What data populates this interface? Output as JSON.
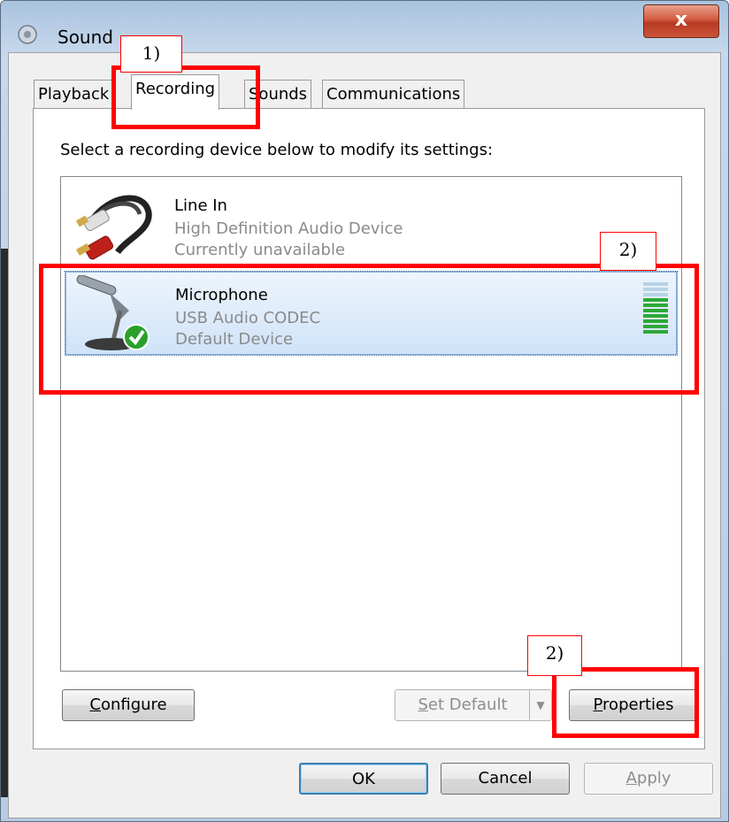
{
  "window": {
    "title": "Sound",
    "close_label": "x"
  },
  "tabs": [
    {
      "label": "Playback",
      "active": false
    },
    {
      "label": "Recording",
      "active": true
    },
    {
      "label": "Sounds",
      "active": false
    },
    {
      "label": "Communications",
      "active": false
    }
  ],
  "instruction": "Select a recording device below to modify its settings:",
  "devices": [
    {
      "name": "Line In",
      "driver": "High Definition Audio Device",
      "status": "Currently unavailable",
      "icon": "rca-cable-icon",
      "selected": false
    },
    {
      "name": "Microphone",
      "driver": "USB Audio CODEC",
      "status": "Default Device",
      "icon": "microphone-icon",
      "selected": true,
      "level_fraction": 0.7
    }
  ],
  "buttons": {
    "configure": "Configure",
    "set_default": "Set Default",
    "properties": "Properties",
    "ok": "OK",
    "cancel": "Cancel",
    "apply": "Apply"
  },
  "annotations": {
    "label_1": "1)",
    "label_2a": "2)",
    "label_2b": "2)",
    "color": "#ff0000"
  }
}
